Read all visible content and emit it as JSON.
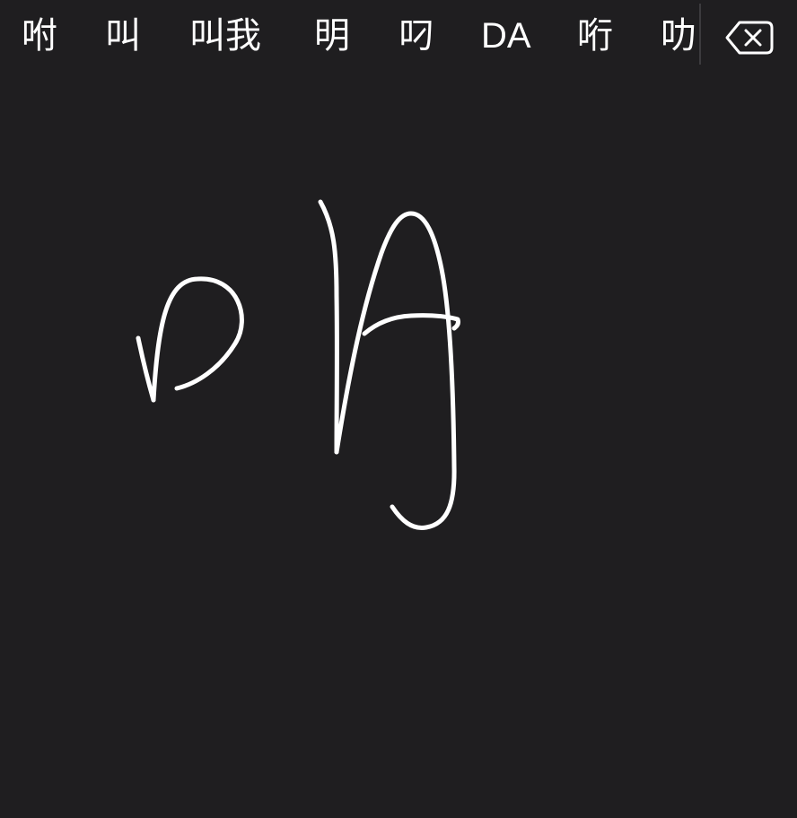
{
  "candidates": [
    "咐",
    "叫",
    "叫我",
    "明",
    "叼",
    "DA",
    "哘",
    "叻"
  ],
  "delete_key": {
    "icon": "delete-backward-icon"
  },
  "colors": {
    "background": "#1f1e20",
    "text": "#ffffff",
    "stroke": "#ffffff",
    "divider": "#3c3b3e"
  }
}
